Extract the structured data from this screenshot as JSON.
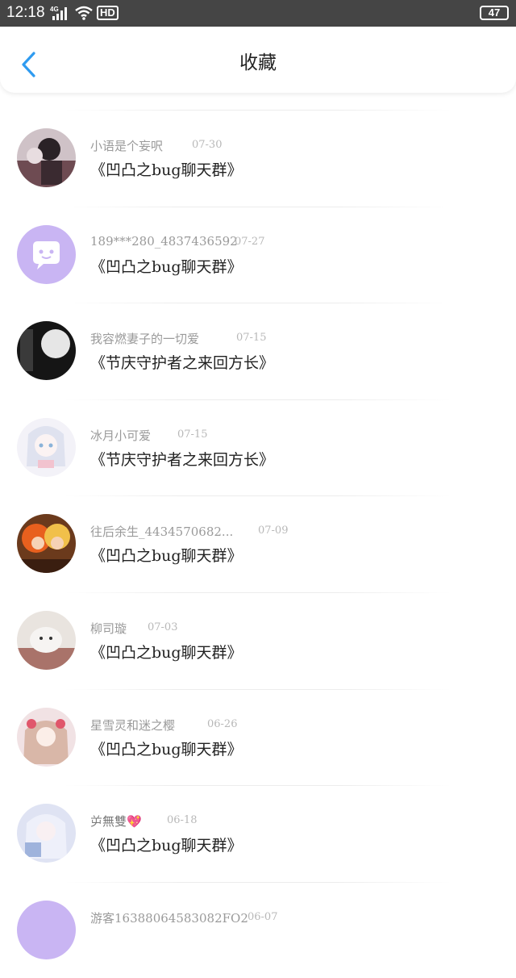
{
  "status_bar": {
    "time": "12:18",
    "network": "4G",
    "hd": "HD",
    "battery": "47"
  },
  "header": {
    "title": "收藏"
  },
  "items": [
    {
      "name": "小语是个妄呎",
      "date": "07-30",
      "group": "《凹凸之bug聊天群》"
    },
    {
      "name": "189***280_4837436592",
      "date": "07-27",
      "group": "《凹凸之bug聊天群》"
    },
    {
      "name": "我容燃妻子的一切爱",
      "date": "07-15",
      "group": "《节庆守护者之来回方长》"
    },
    {
      "name": "冰月小可爱",
      "date": "07-15",
      "group": "《节庆守护者之来回方长》"
    },
    {
      "name": "往后余生_4434570682...",
      "date": "07-09",
      "group": "《凹凸之bug聊天群》"
    },
    {
      "name": "柳司璇",
      "date": "07-03",
      "group": "《凹凸之bug聊天群》"
    },
    {
      "name": "星雪灵和迷之樱",
      "date": "06-26",
      "group": "《凹凸之bug聊天群》"
    },
    {
      "name": "屰無雙💖",
      "date": "06-18",
      "group": "《凹凸之bug聊天群》"
    },
    {
      "name": "游客1638806458308​2FO2",
      "date": "06-07",
      "group": ""
    }
  ],
  "colors": {
    "accent": "#2f9bf0",
    "status_bar": "#454545",
    "avatar_purple": "#c9b5f3"
  }
}
